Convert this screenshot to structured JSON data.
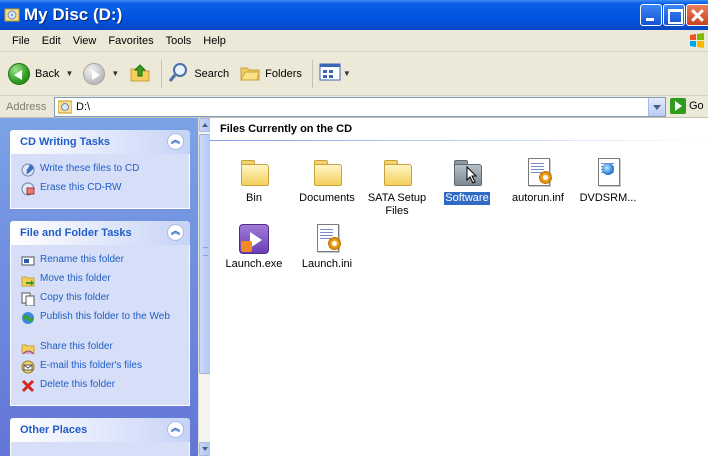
{
  "window": {
    "title": "My Disc (D:)"
  },
  "menu": [
    "File",
    "Edit",
    "View",
    "Favorites",
    "Tools",
    "Help"
  ],
  "toolbar": {
    "back_label": "Back",
    "search_label": "Search",
    "folders_label": "Folders"
  },
  "address": {
    "label": "Address",
    "value": "D:\\",
    "go_label": "Go"
  },
  "panels": [
    {
      "title": "CD Writing Tasks",
      "tasks": [
        {
          "label": "Write these files to CD",
          "icon": "write-cd-icon"
        },
        {
          "label": "Erase this CD-RW",
          "icon": "erase-cd-icon"
        }
      ]
    },
    {
      "title": "File and Folder Tasks",
      "tasks": [
        {
          "label": "Rename this folder",
          "icon": "rename-icon"
        },
        {
          "label": "Move this folder",
          "icon": "move-icon"
        },
        {
          "label": "Copy this folder",
          "icon": "copy-icon"
        },
        {
          "label": "Publish this folder to the Web",
          "icon": "publish-web-icon"
        },
        {
          "label": "Share this folder",
          "icon": "share-icon"
        },
        {
          "label": "E-mail this folder's files",
          "icon": "email-icon"
        },
        {
          "label": "Delete this folder",
          "icon": "delete-icon"
        }
      ]
    },
    {
      "title": "Other Places",
      "tasks": []
    }
  ],
  "content": {
    "group_title": "Files Currently on the CD",
    "files": [
      {
        "name": "Bin",
        "type": "folder"
      },
      {
        "name": "Documents",
        "type": "folder"
      },
      {
        "name": "SATA Setup Files",
        "type": "folder"
      },
      {
        "name": "Software",
        "type": "folder",
        "selected": true
      },
      {
        "name": "autorun.inf",
        "type": "settings-file"
      },
      {
        "name": "DVDSRM...",
        "type": "web-file"
      },
      {
        "name": "Launch.exe",
        "type": "application"
      },
      {
        "name": "Launch.ini",
        "type": "settings-file"
      }
    ]
  },
  "colors": {
    "titlebar": "#0054e3",
    "taskpane": "#6375d6",
    "task_link": "#215dc6",
    "selection": "#316ac5"
  }
}
